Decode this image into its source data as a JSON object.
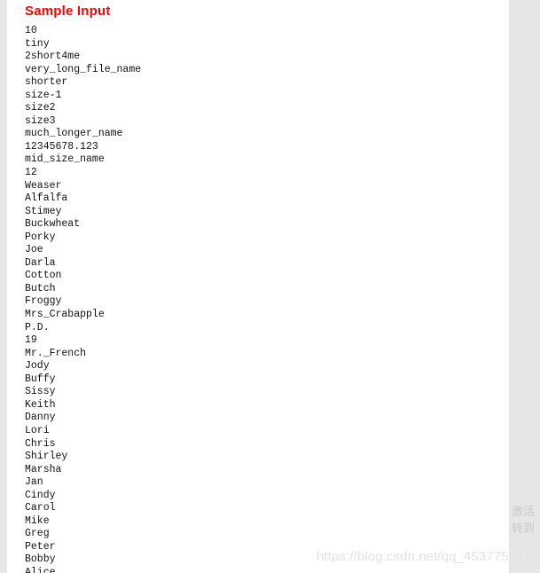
{
  "page": {
    "background_color": "#e6e6e6",
    "sheet_color": "#ffffff"
  },
  "section": {
    "title": "Sample Input",
    "title_color": "#ff0000"
  },
  "sample_input": {
    "lines": [
      "10",
      "tiny",
      "2short4me",
      "very_long_file_name",
      "shorter",
      "size-1",
      "size2",
      "size3",
      "much_longer_name",
      "12345678.123",
      "mid_size_name",
      "12",
      "Weaser",
      "Alfalfa",
      "Stimey",
      "Buckwheat",
      "Porky",
      "Joe",
      "Darla",
      "Cotton",
      "Butch",
      "Froggy",
      "Mrs_Crabapple",
      "P.D.",
      "19",
      "Mr._French",
      "Jody",
      "Buffy",
      "Sissy",
      "Keith",
      "Danny",
      "Lori",
      "Chris",
      "Shirley",
      "Marsha",
      "Jan",
      "Cindy",
      "Carol",
      "Mike",
      "Greg",
      "Peter",
      "Bobby",
      "Alice"
    ]
  },
  "watermarks": {
    "blog_url": "https://blog.csdn.net/qq_45377553",
    "activation_line_1": "激活",
    "activation_line_2": "转到"
  }
}
